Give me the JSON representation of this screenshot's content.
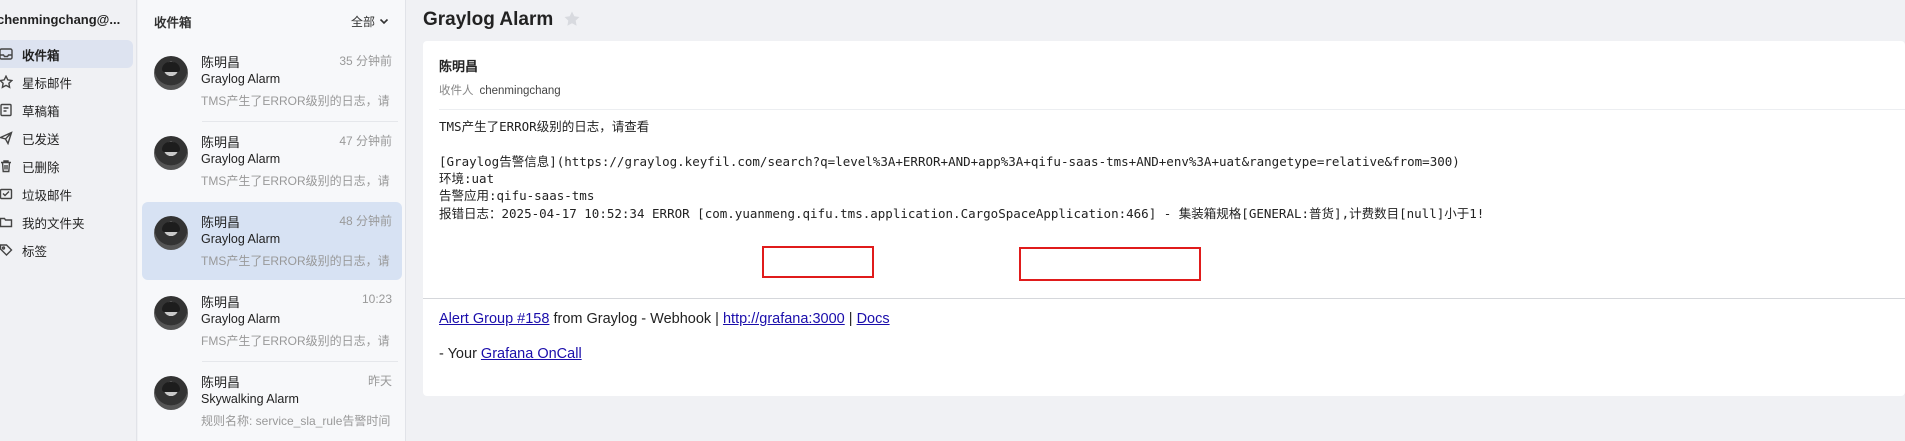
{
  "account": "chenmingchang@...",
  "nav": [
    {
      "label": "收件箱",
      "icon": "inbox-icon",
      "active": true
    },
    {
      "label": "星标邮件",
      "icon": "star-icon"
    },
    {
      "label": "草稿箱",
      "icon": "draft-icon"
    },
    {
      "label": "已发送",
      "icon": "send-icon"
    },
    {
      "label": "已删除",
      "icon": "trash-icon"
    },
    {
      "label": "垃圾邮件",
      "icon": "spam-icon"
    },
    {
      "label": "我的文件夹",
      "icon": "folder-icon"
    },
    {
      "label": "标签",
      "icon": "tag-icon"
    }
  ],
  "list": {
    "title": "收件箱",
    "filter": "全部",
    "messages": [
      {
        "sender": "陈明昌",
        "time": "35 分钟前",
        "subject": "Graylog Alarm",
        "preview": "TMS产生了ERROR级别的日志，请"
      },
      {
        "sender": "陈明昌",
        "time": "47 分钟前",
        "subject": "Graylog Alarm",
        "preview": "TMS产生了ERROR级别的日志，请"
      },
      {
        "sender": "陈明昌",
        "time": "48 分钟前",
        "subject": "Graylog Alarm",
        "preview": "TMS产生了ERROR级别的日志，请"
      },
      {
        "sender": "陈明昌",
        "time": "10:23",
        "subject": "Graylog Alarm",
        "preview": "FMS产生了ERROR级别的日志，请"
      },
      {
        "sender": "陈明昌",
        "time": "昨天",
        "subject": "Skywalking Alarm",
        "preview": "规则名称: service_sla_rule告警时间"
      }
    ]
  },
  "reader": {
    "title": "Graylog Alarm",
    "from": "陈明昌",
    "to_label": "收件人",
    "to_name": "chenmingchang",
    "body": [
      "TMS产生了ERROR级别的日志，请查看",
      "[Graylog告警信息](https://graylog.keyfil.com/search?q=level%3A+ERROR+AND+app%3A+qifu-saas-tms+AND+env%3A+uat&rangetype=relative&from=300)",
      "环境:uat",
      "告警应用:qifu-saas-tms",
      "报错日志：2025-04-17 10:52:34 ERROR [com.yuanmeng.qifu.tms.application.CargoSpaceApplication:466] - 集装箱规格[GENERAL:普货],计费数目[null]小于1!"
    ],
    "alert_link": "Alert Group #158",
    "from_text": " from Graylog - Webhook | ",
    "grafana_link": "http://grafana:3000",
    "pipe": " | ",
    "docs_link": "Docs",
    "sig_prefix": "- Your ",
    "oncall_link": "Grafana OnCall"
  },
  "colors": {
    "link": "#1a0dab",
    "highlight": "#e01b1b",
    "selected": "#d7e2f3"
  }
}
